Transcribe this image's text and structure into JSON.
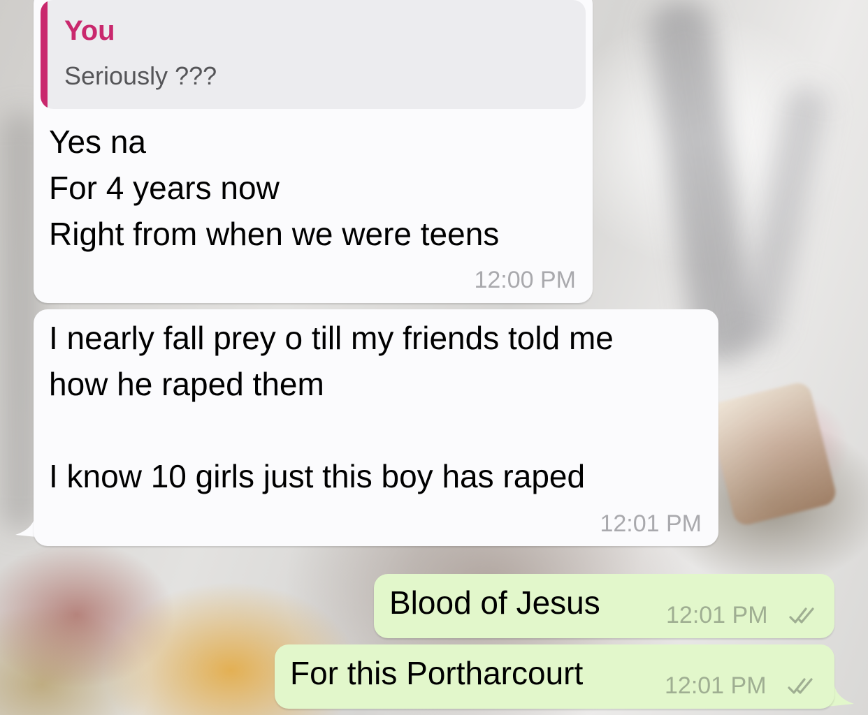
{
  "messages": [
    {
      "direction": "incoming",
      "reply": {
        "author": "You",
        "text": "Seriously ???"
      },
      "text": "Yes na\nFor 4 years now\nRight from when we were teens",
      "time": "12:00 PM"
    },
    {
      "direction": "incoming",
      "text": "I nearly fall prey o till my friends told me\nhow he raped them\n\nI know 10 girls just this boy has raped",
      "time": "12:01 PM"
    },
    {
      "direction": "outgoing",
      "text": "Blood of Jesus",
      "time": "12:01 PM",
      "status_icon": "double-check-icon"
    },
    {
      "direction": "outgoing",
      "text": "For this Portharcourt",
      "time": "12:01 PM",
      "status_icon": "double-check-icon"
    }
  ],
  "colors": {
    "incoming_bubble": "#fbfbfd",
    "outgoing_bubble": "#e2f7cb",
    "reply_accent": "#c9286d",
    "timestamp": "#a9a9ad"
  }
}
